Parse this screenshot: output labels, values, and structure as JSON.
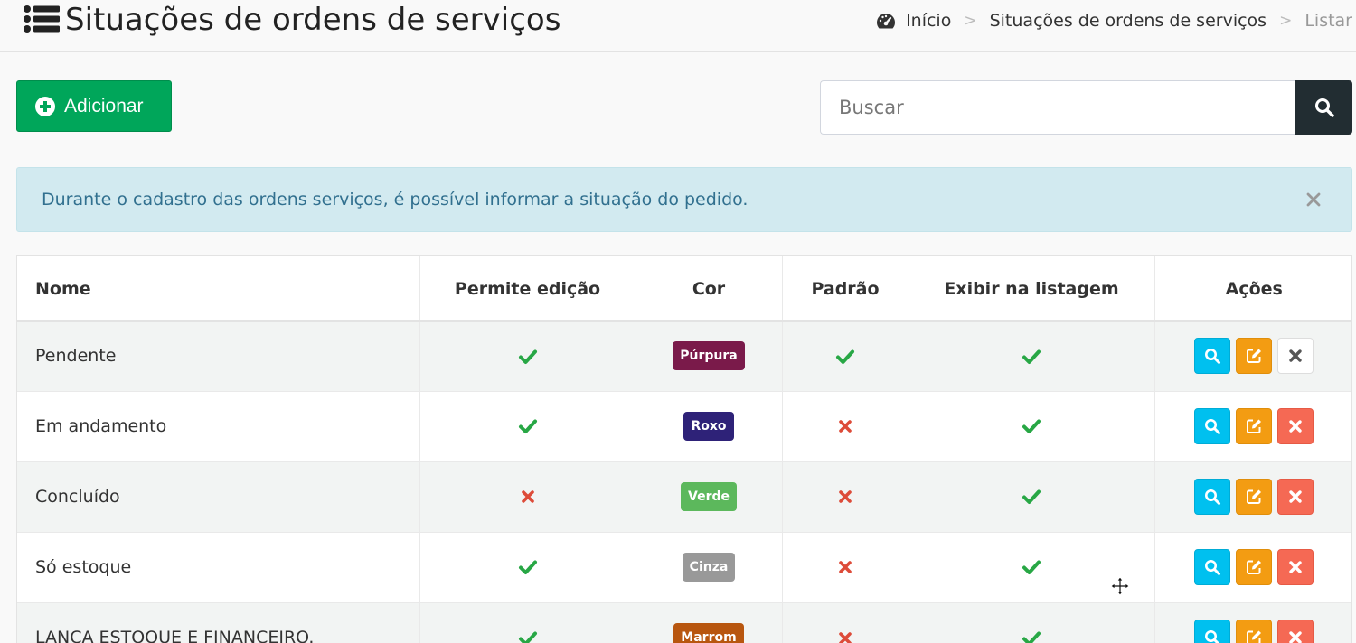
{
  "header": {
    "title": "Situações de ordens de serviços",
    "breadcrumb": [
      {
        "label": "Início"
      },
      {
        "label": "Situações de ordens de serviços"
      },
      {
        "label": "Listar"
      }
    ],
    "breadcrumb_separator": ">"
  },
  "toolbar": {
    "add_label": "Adicionar",
    "search_placeholder": "Buscar"
  },
  "alert": {
    "text": "Durante o cadastro das ordens serviços, é possível informar a situação do pedido."
  },
  "table": {
    "columns": [
      "Nome",
      "Permite edição",
      "Cor",
      "Padrão",
      "Exibir na listagem",
      "Ações"
    ],
    "rows": [
      {
        "name": "Pendente",
        "permite_edicao": true,
        "cor": "Púrpura",
        "cor_hex": "#7a1a4a",
        "padrao": true,
        "exibir": true,
        "delete_enabled": false
      },
      {
        "name": "Em andamento",
        "permite_edicao": true,
        "cor": "Roxo",
        "cor_hex": "#2e2278",
        "padrao": false,
        "exibir": true,
        "delete_enabled": true
      },
      {
        "name": "Concluído",
        "permite_edicao": false,
        "cor": "Verde",
        "cor_hex": "#5cb85c",
        "padrao": false,
        "exibir": true,
        "delete_enabled": true
      },
      {
        "name": "Só estoque",
        "permite_edicao": true,
        "cor": "Cinza",
        "cor_hex": "#999999",
        "padrao": false,
        "exibir": true,
        "delete_enabled": true
      },
      {
        "name": "LANÇA ESTOQUE E FINANCEIRO.",
        "permite_edicao": true,
        "cor": "Marrom",
        "cor_hex": "#b8560f",
        "padrao": false,
        "exibir": true,
        "delete_enabled": true
      }
    ]
  },
  "colors": {
    "success": "#00a65a",
    "check": "#28a745",
    "cross": "#dd4b39",
    "info": "#00c0ef",
    "warning": "#f39c12",
    "danger": "#f56954",
    "dark": "#222d32"
  },
  "icons": {
    "title": "list-icon",
    "breadcrumb_home": "dashboard-icon",
    "add": "plus-circle-icon",
    "search": "search-icon",
    "alert_close": "close-icon",
    "true": "check-icon",
    "false": "cross-icon",
    "view": "search-icon",
    "edit": "edit-icon",
    "delete": "delete-icon",
    "cursor": "move-cursor-icon"
  }
}
